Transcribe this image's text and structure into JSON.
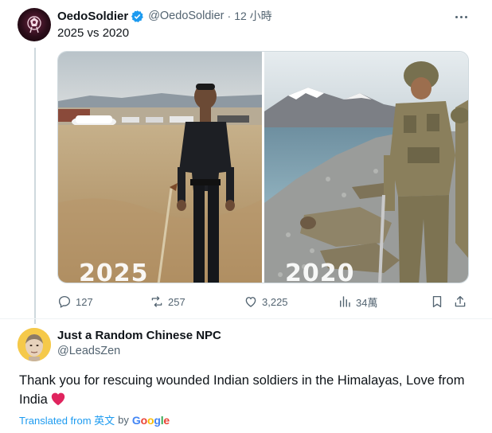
{
  "tweet": {
    "display_name": "OedoSoldier",
    "handle": "@OedoSoldier",
    "separator": "·",
    "time": "12 小時",
    "text": "2025 vs 2020",
    "media": {
      "left_year": "2025",
      "right_year": "2020"
    },
    "actions": {
      "replies": "127",
      "reposts": "257",
      "likes": "3,225",
      "views": "34萬"
    },
    "icons": {
      "verified": "verified-badge-icon",
      "more": "more-dots-icon",
      "reply": "reply-icon",
      "repost": "repost-icon",
      "like": "heart-icon",
      "views": "views-chart-icon",
      "bookmark": "bookmark-icon",
      "share": "share-icon"
    }
  },
  "reply": {
    "display_name": "Just a Random Chinese NPC",
    "handle": "@LeadsZen",
    "text": "Thank you for rescuing wounded Indian soldiers in the Himalayas, Love from India",
    "translated_label": "Translated from 英文",
    "by_label": "by",
    "google_label": "Google"
  },
  "colors": {
    "accent": "#1d9bf0",
    "secondary_text": "#536471",
    "primary_text": "#0f1419",
    "heart_emoji": "#e0245e"
  }
}
